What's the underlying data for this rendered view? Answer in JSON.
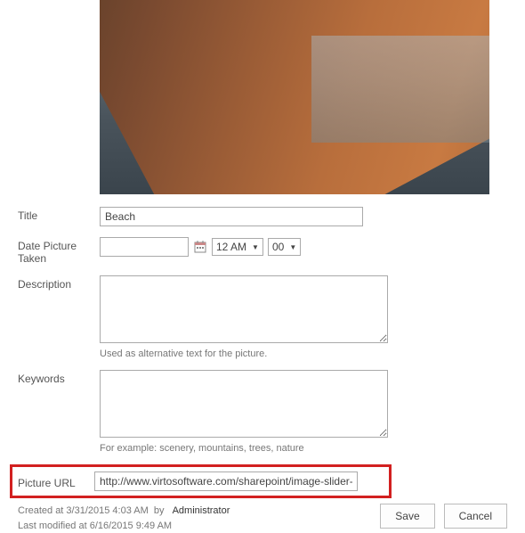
{
  "labels": {
    "title": "Title",
    "date_taken": "Date Picture Taken",
    "description": "Description",
    "keywords": "Keywords",
    "picture_url": "Picture URL"
  },
  "values": {
    "title": "Beach",
    "date": "",
    "hour": "12 AM",
    "minute": "00",
    "description": "",
    "keywords": "",
    "picture_url": "http://www.virtosoftware.com/sharepoint/image-slider-web-part"
  },
  "helpers": {
    "description": "Used as alternative text for the picture.",
    "keywords": "For example: scenery, mountains, trees, nature"
  },
  "meta": {
    "created_prefix": "Created at ",
    "created_date": "3/31/2015 4:03 AM",
    "created_by_word": "by",
    "created_user": "Administrator",
    "modified_prefix": "Last modified at ",
    "modified_date": "6/16/2015 9:49 AM"
  },
  "buttons": {
    "save": "Save",
    "cancel": "Cancel"
  }
}
